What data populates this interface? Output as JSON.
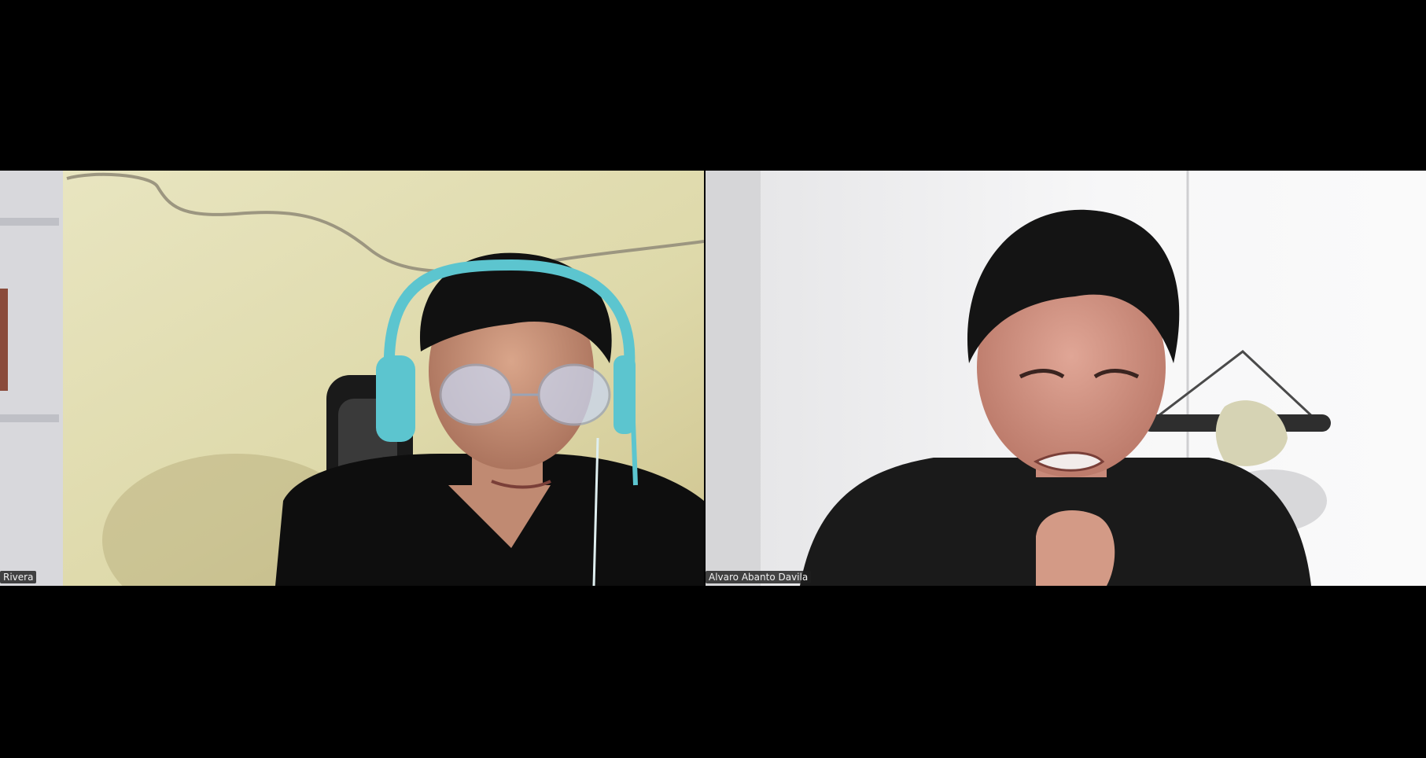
{
  "meeting": {
    "participants": [
      {
        "name": "Rivera",
        "camera": "on"
      },
      {
        "name": "Alvaro Abanto Davila",
        "camera": "on"
      }
    ]
  },
  "colors": {
    "background": "#000000",
    "name_tag_bg": "#1e1e1e",
    "name_tag_text": "#f2f2f2",
    "headset": "#5cc5cf"
  }
}
